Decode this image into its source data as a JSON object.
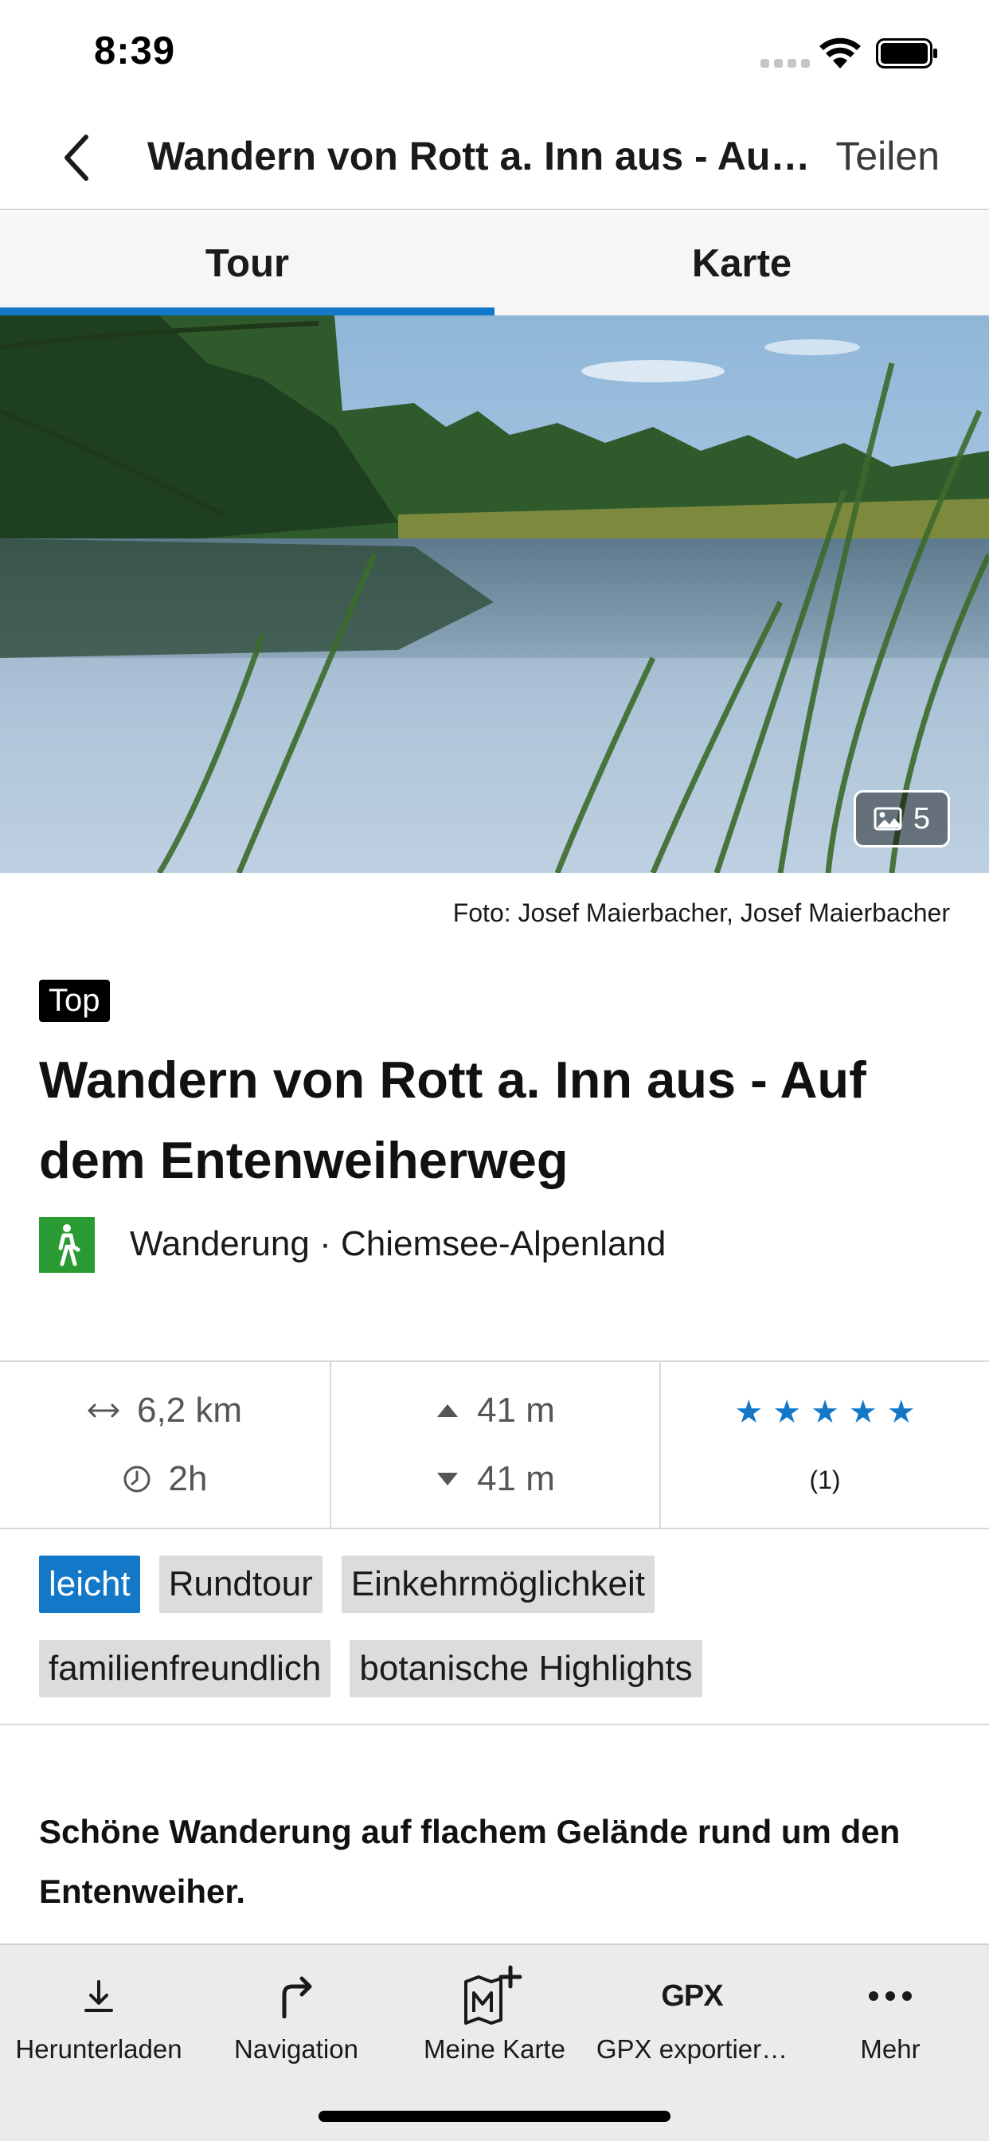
{
  "status_bar": {
    "time": "8:39"
  },
  "nav": {
    "title": "Wandern von Rott a. Inn aus - Auf dem Entenweiherweg",
    "share_label": "Teilen"
  },
  "tabs": [
    {
      "label": "Tour",
      "active": true
    },
    {
      "label": "Karte",
      "active": false
    }
  ],
  "hero": {
    "photo_count": "5"
  },
  "caption": "Foto: Josef Maierbacher, Josef Maierbacher",
  "badge": "Top",
  "title": "Wandern von Rott a. Inn aus - Auf dem Entenweiherweg",
  "category": {
    "icon": "hiking-icon",
    "text": "Wanderung · Chiemsee-Alpenland",
    "color": "#2a9b32"
  },
  "stats": {
    "distance": "6,2 km",
    "duration": "2h",
    "ascent": "41 m",
    "descent": "41 m",
    "rating_stars": 5,
    "rating_count": "(1)"
  },
  "tags": [
    {
      "label": "leicht",
      "primary": true
    },
    {
      "label": "Rundtour",
      "primary": false
    },
    {
      "label": "Einkehrmöglichkeit",
      "primary": false
    },
    {
      "label": "familienfreundlich",
      "primary": false
    },
    {
      "label": "botanische Highlights",
      "primary": false
    }
  ],
  "description": "Schöne Wanderung auf flachem Gelände rund um den Entenweiher.",
  "toolbar": {
    "download": "Herunterladen",
    "navigation": "Navigation",
    "my_map": "Meine Karte",
    "gpx_icon_text": "GPX",
    "gpx_export": "GPX exportier…",
    "more": "Mehr"
  },
  "colors": {
    "accent": "#1478c8",
    "category": "#2a9b32"
  }
}
